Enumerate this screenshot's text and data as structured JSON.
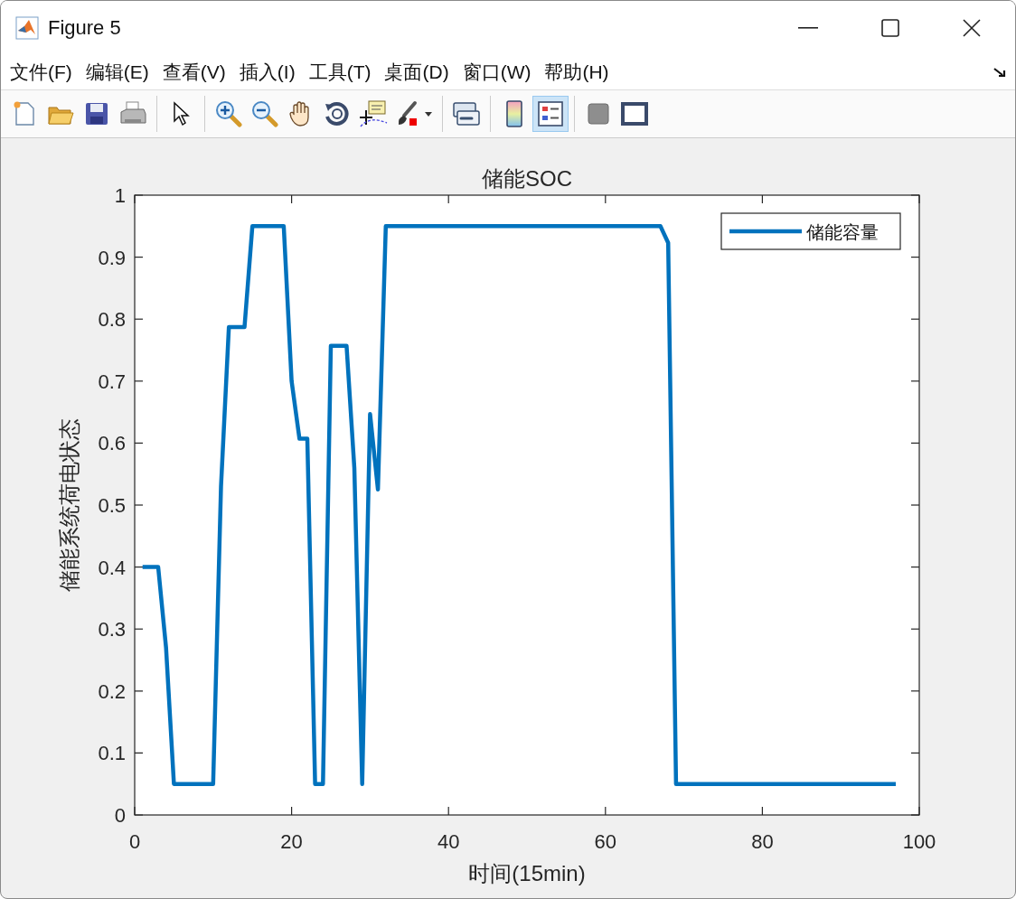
{
  "window": {
    "title": "Figure 5"
  },
  "menu": [
    {
      "label": "文件(F)"
    },
    {
      "label": "编辑(E)"
    },
    {
      "label": "查看(V)"
    },
    {
      "label": "插入(I)"
    },
    {
      "label": "工具(T)"
    },
    {
      "label": "桌面(D)"
    },
    {
      "label": "窗口(W)"
    },
    {
      "label": "帮助(H)"
    }
  ],
  "toolbar": [
    [
      {
        "kind": "new",
        "selected": false
      },
      {
        "kind": "open",
        "selected": false
      },
      {
        "kind": "save",
        "selected": false
      },
      {
        "kind": "print",
        "selected": false
      }
    ],
    [
      {
        "kind": "pointer",
        "selected": false
      }
    ],
    [
      {
        "kind": "zoomin",
        "selected": false
      },
      {
        "kind": "zoomout",
        "selected": false
      },
      {
        "kind": "pan",
        "selected": false
      },
      {
        "kind": "rotate",
        "selected": false
      },
      {
        "kind": "datatip",
        "selected": false
      },
      {
        "kind": "brush",
        "selected": false
      }
    ],
    [
      {
        "kind": "link",
        "selected": false
      }
    ],
    [
      {
        "kind": "colorbar",
        "selected": false
      },
      {
        "kind": "legend",
        "selected": true
      }
    ],
    [
      {
        "kind": "hide",
        "selected": false
      },
      {
        "kind": "frame",
        "selected": false
      }
    ]
  ],
  "figure": {
    "chart_data": {
      "type": "line",
      "title": "储能SOC",
      "xlabel": "时间(15min)",
      "ylabel": "储能系统荷电状态",
      "xlim": [
        0,
        100
      ],
      "ylim": [
        0,
        1
      ],
      "xticks": [
        0,
        20,
        40,
        60,
        80,
        100
      ],
      "yticks": [
        0,
        0.1,
        0.2,
        0.3,
        0.4,
        0.5,
        0.6,
        0.7,
        0.8,
        0.9,
        1
      ],
      "x": [
        1,
        3,
        4,
        5,
        10,
        11,
        12,
        14,
        15,
        19,
        20,
        21,
        22,
        23,
        24,
        25,
        27,
        28,
        29,
        30,
        31,
        32,
        67,
        68,
        69,
        97
      ],
      "series": [
        {
          "name": "储能容量",
          "color": "#0072bd",
          "values": [
            0.4,
            0.4,
            0.27,
            0.05,
            0.05,
            0.53,
            0.787,
            0.787,
            0.95,
            0.95,
            0.7,
            0.607,
            0.607,
            0.05,
            0.05,
            0.757,
            0.757,
            0.56,
            0.05,
            0.647,
            0.525,
            0.95,
            0.95,
            0.923,
            0.05,
            0.05
          ]
        }
      ]
    }
  }
}
